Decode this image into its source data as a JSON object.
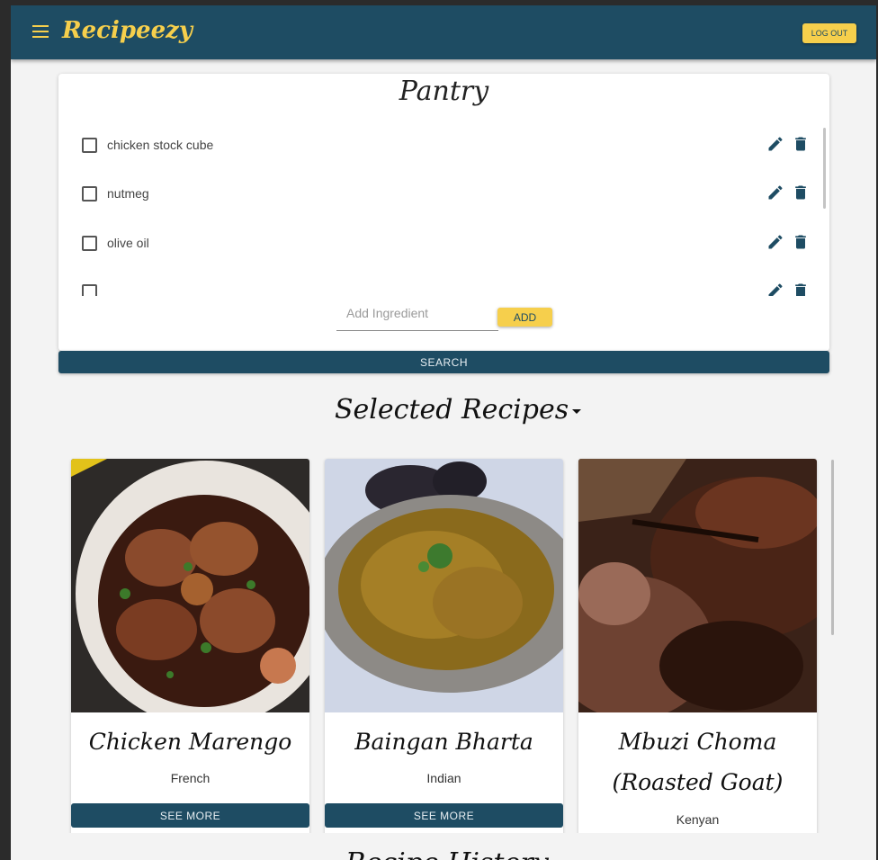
{
  "appbar": {
    "brand": "Recipeezy",
    "logout_label": "LOG OUT",
    "menu_icon": "menu-icon"
  },
  "pantry": {
    "title": "Pantry",
    "items": [
      {
        "label": "chicken stock cube",
        "checked": false
      },
      {
        "label": "nutmeg",
        "checked": false
      },
      {
        "label": "olive oil",
        "checked": false
      },
      {
        "label": "",
        "checked": false
      }
    ],
    "add_placeholder": "Add Ingredient",
    "add_label": "ADD",
    "search_label": "SEARCH"
  },
  "selected": {
    "title": "Selected Recipes",
    "recipes": [
      {
        "name": "Chicken Marengo",
        "cuisine": "French",
        "see_more": "SEE MORE"
      },
      {
        "name": "Baingan Bharta",
        "cuisine": "Indian",
        "see_more": "SEE MORE"
      },
      {
        "name": "Mbuzi Choma (Roasted Goat)",
        "cuisine": "Kenyan",
        "see_more": ""
      }
    ]
  },
  "next_section": {
    "title": "Recipe History"
  },
  "colors": {
    "primary": "#1e4c63",
    "accent": "#f6cf4c"
  }
}
